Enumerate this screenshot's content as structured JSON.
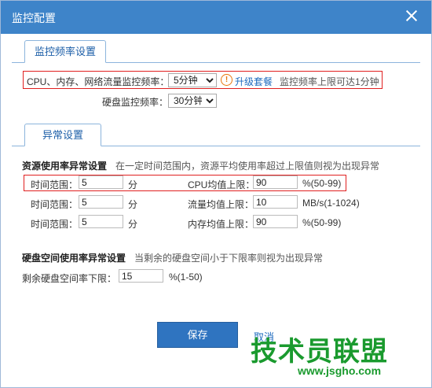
{
  "dialog": {
    "title": "监控配置"
  },
  "frequency": {
    "tab": "监控频率设置",
    "cpu_label": "CPU、内存、网络流量监控频率：",
    "cpu_value": "5分钟",
    "upgrade_link": "升级套餐",
    "upgrade_note": "监控频率上限可达1分钟",
    "disk_label": "硬盘监控频率：",
    "disk_value": "30分钟"
  },
  "anomaly": {
    "tab": "异常设置",
    "resource_title": "资源使用率异常设置",
    "resource_desc": "在一定时间范围内，资源平均使用率超过上限值则视为出现异常",
    "rows": [
      {
        "time_label": "时间范围：",
        "time_value": "5",
        "time_unit": "分",
        "limit_label": "CPU均值上限：",
        "limit_value": "90",
        "limit_unit": "%(50-99)"
      },
      {
        "time_label": "时间范围：",
        "time_value": "5",
        "time_unit": "分",
        "limit_label": "流量均值上限：",
        "limit_value": "10",
        "limit_unit": "MB/s(1-1024)"
      },
      {
        "time_label": "时间范围：",
        "time_value": "5",
        "time_unit": "分",
        "limit_label": "内存均值上限：",
        "limit_value": "90",
        "limit_unit": "%(50-99)"
      }
    ],
    "disk_title": "硬盘空间使用率异常设置",
    "disk_desc": "当剩余的硬盘空间小于下限率则视为出现异常",
    "disk_label": "剩余硬盘空间率下限：",
    "disk_value": "15",
    "disk_unit": "%(1-50)"
  },
  "footer": {
    "save": "保存",
    "cancel": "取消"
  },
  "watermark": {
    "text": "技术员联盟",
    "url": "www.jsgho.com"
  },
  "colors": {
    "titlebar": "#3e84c9",
    "accent": "#1e6bbf",
    "highlight": "#e02020",
    "warning": "#e8750b"
  }
}
